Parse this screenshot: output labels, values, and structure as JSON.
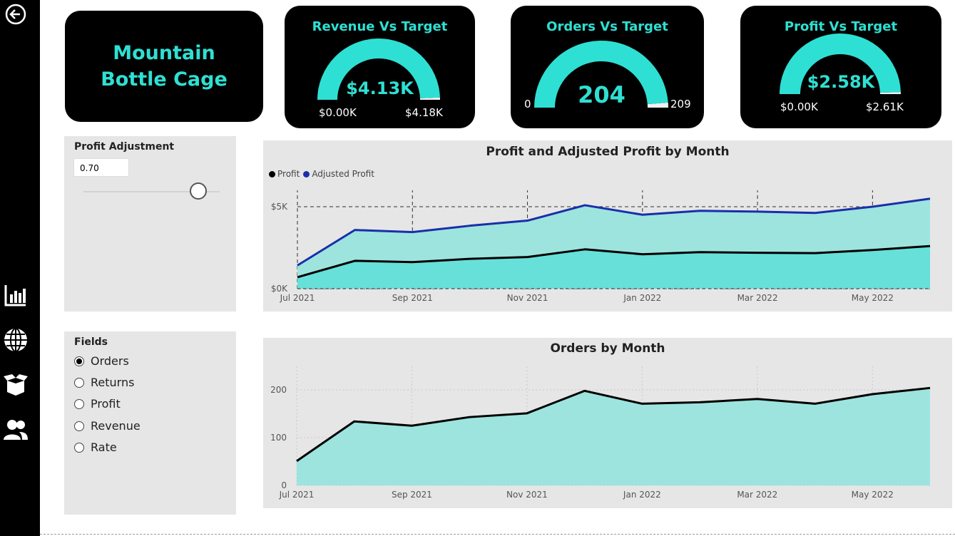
{
  "sidebar": {
    "icons": [
      "back-arrow-icon",
      "bar-chart-icon",
      "globe-icon",
      "box-icon",
      "users-icon"
    ]
  },
  "title": "Mountain Bottle Cage",
  "kpis": [
    {
      "title": "Revenue Vs Target",
      "value": "$4.13K",
      "min": "$0.00K",
      "max": "$4.18K",
      "fraction": 0.988
    },
    {
      "title": "Orders Vs Target",
      "value": "204",
      "min": "0",
      "max": "209",
      "fraction": 0.976
    },
    {
      "title": "Profit Vs Target",
      "value": "$2.58K",
      "min": "$0.00K",
      "max": "$2.61K",
      "fraction": 0.989
    }
  ],
  "profit_adjustment": {
    "label": "Profit Adjustment",
    "value": "0.70",
    "slider_fraction": 0.85
  },
  "fields": {
    "label": "Fields",
    "options": [
      "Orders",
      "Returns",
      "Profit",
      "Revenue",
      "Rate"
    ],
    "selected": "Orders"
  },
  "colors": {
    "accent": "#2ee0d3",
    "adjusted_profit": "#1a2fa8",
    "area_light": "#9de4df",
    "area_dark": "#66e0d9"
  },
  "chart_data": [
    {
      "type": "area",
      "title": "Profit and Adjusted Profit by Month",
      "x": [
        "Jul 2021",
        "Aug 2021",
        "Sep 2021",
        "Oct 2021",
        "Nov 2021",
        "Dec 2021",
        "Jan 2022",
        "Feb 2022",
        "Mar 2022",
        "Apr 2022",
        "May 2022",
        "Jun 2022"
      ],
      "tick_labels": [
        "Jul 2021",
        "Sep 2021",
        "Nov 2021",
        "Jan 2022",
        "Mar 2022",
        "May 2022"
      ],
      "y_ticks": [
        "$0K",
        "$5K"
      ],
      "ylim": [
        0,
        5000
      ],
      "legend": "top-left",
      "series": [
        {
          "name": "Profit",
          "values": [
            700,
            1700,
            1620,
            1820,
            1930,
            2400,
            2100,
            2230,
            2190,
            2170,
            2360,
            2600
          ]
        },
        {
          "name": "Adjusted Profit",
          "values": [
            1420,
            3580,
            3450,
            3840,
            4150,
            5090,
            4510,
            4750,
            4700,
            4620,
            5000,
            5490
          ]
        }
      ]
    },
    {
      "type": "area",
      "title": "Orders by Month",
      "x": [
        "Jul 2021",
        "Aug 2021",
        "Sep 2021",
        "Oct 2021",
        "Nov 2021",
        "Dec 2021",
        "Jan 2022",
        "Feb 2022",
        "Mar 2022",
        "Apr 2022",
        "May 2022",
        "Jun 2022"
      ],
      "tick_labels": [
        "Jul 2021",
        "Sep 2021",
        "Nov 2021",
        "Jan 2022",
        "Mar 2022",
        "May 2022"
      ],
      "y_ticks": [
        "0",
        "100",
        "200"
      ],
      "ylim": [
        0,
        200
      ],
      "series": [
        {
          "values": [
            51,
            134,
            125,
            143,
            151,
            198,
            171,
            174,
            181,
            171,
            191,
            204
          ]
        }
      ]
    }
  ]
}
